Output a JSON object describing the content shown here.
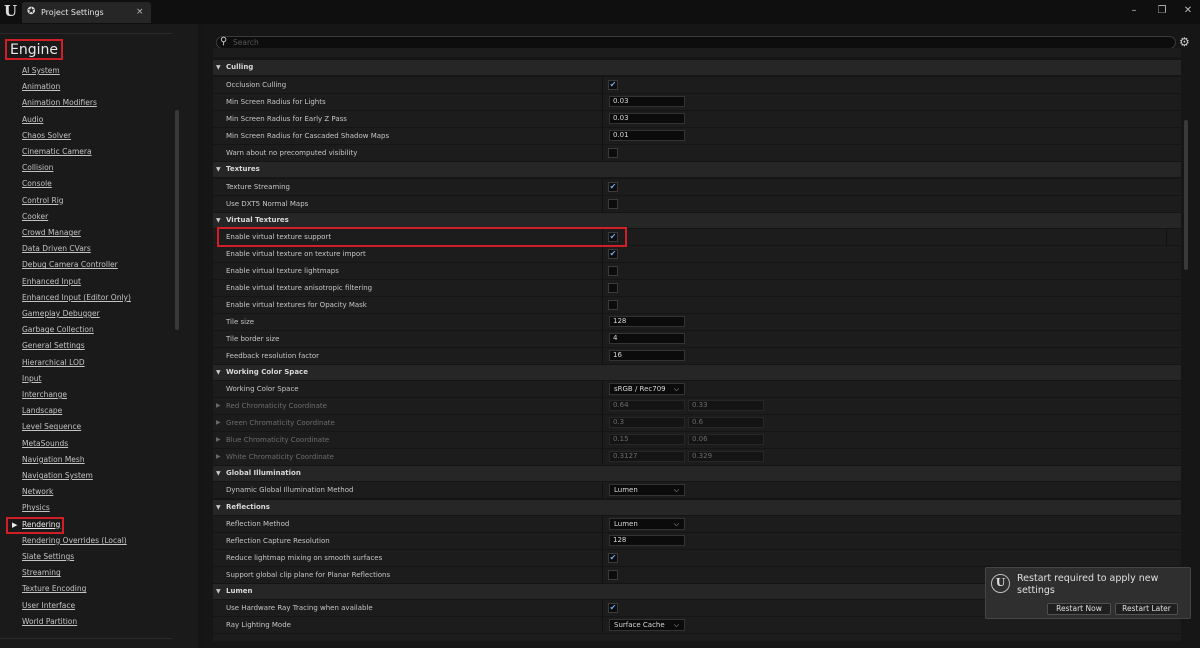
{
  "window": {
    "tab_label": "Project Settings",
    "tab_close": "×",
    "minimize": "–",
    "maximize": "❐",
    "close": "✕"
  },
  "sidebar": {
    "heading": "Engine",
    "items": [
      "AI System",
      "Animation",
      "Animation Modifiers",
      "Audio",
      "Chaos Solver",
      "Cinematic Camera",
      "Collision",
      "Console",
      "Control Rig",
      "Cooker",
      "Crowd Manager",
      "Data Driven CVars",
      "Debug Camera Controller",
      "Enhanced Input",
      "Enhanced Input (Editor Only)",
      "Gameplay Debugger",
      "Garbage Collection",
      "General Settings",
      "Hierarchical LOD",
      "Input",
      "Interchange",
      "Landscape",
      "Level Sequence",
      "MetaSounds",
      "Navigation Mesh",
      "Navigation System",
      "Network",
      "Physics",
      "Rendering",
      "Rendering Overrides (Local)",
      "Slate Settings",
      "Streaming",
      "Texture Encoding",
      "User Interface",
      "World Partition"
    ],
    "selected": "Rendering"
  },
  "search": {
    "placeholder": "Search"
  },
  "sections": {
    "culling": {
      "title": "Culling",
      "occlusion_culling": "Occlusion Culling",
      "min_screen_radius_lights": "Min Screen Radius for Lights",
      "min_screen_radius_lights_value": "0.03",
      "min_screen_radius_early_z": "Min Screen Radius for Early Z Pass",
      "min_screen_radius_early_z_value": "0.03",
      "min_screen_radius_csm": "Min Screen Radius for Cascaded Shadow Maps",
      "min_screen_radius_csm_value": "0.01",
      "warn_no_precomputed": "Warn about no precomputed visibility"
    },
    "textures": {
      "title": "Textures",
      "texture_streaming": "Texture Streaming",
      "use_dxt5": "Use DXT5 Normal Maps"
    },
    "virtual_textures": {
      "title": "Virtual Textures",
      "enable_support": "Enable virtual texture support",
      "enable_on_import": "Enable virtual texture on texture import",
      "enable_lightmaps": "Enable virtual texture lightmaps",
      "enable_aniso": "Enable virtual texture anisotropic filtering",
      "enable_opacity": "Enable virtual textures for Opacity Mask",
      "tile_size": "Tile size",
      "tile_size_value": "128",
      "tile_border": "Tile border size",
      "tile_border_value": "4",
      "feedback_factor": "Feedback resolution factor",
      "feedback_factor_value": "16"
    },
    "working_color_space": {
      "title": "Working Color Space",
      "working_color_space": "Working Color Space",
      "working_color_space_value": "sRGB / Rec709",
      "red": "Red Chromaticity Coordinate",
      "red_x": "0.64",
      "red_y": "0.33",
      "green": "Green Chromaticity Coordinate",
      "green_x": "0.3",
      "green_y": "0.6",
      "blue": "Blue Chromaticity Coordinate",
      "blue_x": "0.15",
      "blue_y": "0.06",
      "white": "White Chromaticity Coordinate",
      "white_x": "0.3127",
      "white_y": "0.329"
    },
    "global_illumination": {
      "title": "Global Illumination",
      "dynamic_gi": "Dynamic Global Illumination Method",
      "dynamic_gi_value": "Lumen"
    },
    "reflections": {
      "title": "Reflections",
      "method": "Reflection Method",
      "method_value": "Lumen",
      "capture_res": "Reflection Capture Resolution",
      "capture_res_value": "128",
      "reduce_lightmap": "Reduce lightmap mixing on smooth surfaces",
      "clip_plane": "Support global clip plane for Planar Reflections"
    },
    "lumen": {
      "title": "Lumen",
      "hw_rt": "Use Hardware Ray Tracing when available",
      "ray_lighting": "Ray Lighting Mode",
      "ray_lighting_value": "Surface Cache"
    }
  },
  "toast": {
    "message": "Restart required to apply new settings",
    "restart_now": "Restart Now",
    "restart_later": "Restart Later"
  },
  "colors": {
    "highlight_red": "#d01f26",
    "check_blue": "#6fa7e8"
  }
}
